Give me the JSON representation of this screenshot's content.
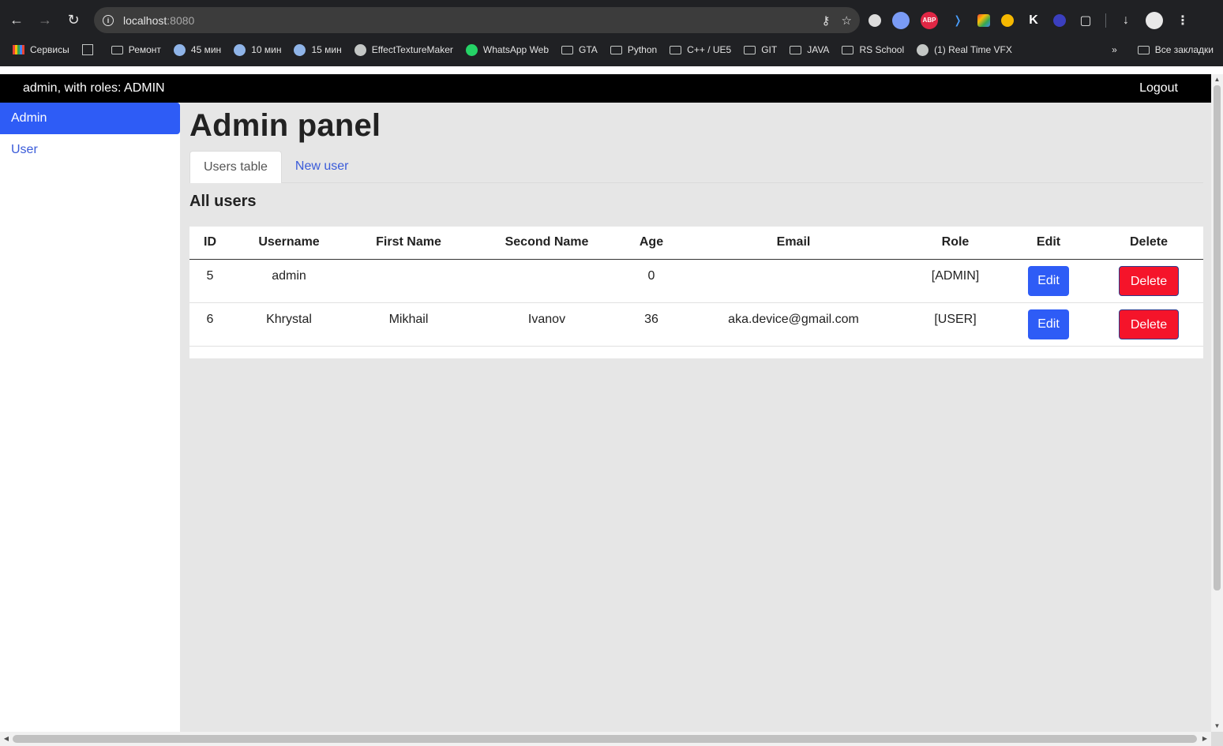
{
  "browser": {
    "url_host": "localhost",
    "url_port": ":8080",
    "icons": {
      "back": "arrow-left-icon",
      "forward": "arrow-right-icon",
      "reload": "reload-icon",
      "key": "key-icon",
      "star": "star-icon"
    },
    "bookmarks": [
      {
        "label": "Сервисы",
        "icon": "apps-grid-icon"
      },
      {
        "label": "",
        "icon": "tab-groups-icon"
      },
      {
        "label": "Ремонт",
        "icon": "folder-icon"
      },
      {
        "label": "45 мин",
        "icon": "timer-icon"
      },
      {
        "label": "10 мин",
        "icon": "timer-icon"
      },
      {
        "label": "15 мин",
        "icon": "timer-icon"
      },
      {
        "label": "EffectTextureMaker",
        "icon": "globe-icon"
      },
      {
        "label": "WhatsApp Web",
        "icon": "whatsapp-icon"
      },
      {
        "label": "GTA",
        "icon": "folder-icon"
      },
      {
        "label": "Python",
        "icon": "folder-icon"
      },
      {
        "label": "C++ / UE5",
        "icon": "folder-icon"
      },
      {
        "label": "GIT",
        "icon": "folder-icon"
      },
      {
        "label": "JAVA",
        "icon": "folder-icon"
      },
      {
        "label": "RS School",
        "icon": "folder-icon"
      },
      {
        "label": "(1) Real Time VFX",
        "icon": "globe-icon"
      }
    ],
    "bookmarks_more": "»",
    "all_bookmarks": "Все закладки",
    "extensions": {
      "abp_label": "ABP",
      "k_label": "K"
    }
  },
  "page": {
    "topnav": {
      "who": "admin, with roles: ADMIN",
      "logout": "Logout"
    },
    "sidebar": {
      "items": [
        {
          "label": "Admin",
          "active": true
        },
        {
          "label": "User",
          "active": false
        }
      ]
    },
    "title": "Admin panel",
    "tabs": [
      {
        "label": "Users table",
        "active": true
      },
      {
        "label": "New user",
        "active": false
      }
    ],
    "section_title": "All users",
    "table": {
      "headers": [
        "ID",
        "Username",
        "First Name",
        "Second Name",
        "Age",
        "Email",
        "Role",
        "Edit",
        "Delete"
      ],
      "rows": [
        {
          "id": "5",
          "username": "admin",
          "first_name": "",
          "second_name": "",
          "age": "0",
          "email": "",
          "role": "[ADMIN]",
          "edit": "Edit",
          "delete": "Delete"
        },
        {
          "id": "6",
          "username": "Khrystal",
          "first_name": "Mikhail",
          "second_name": "Ivanov",
          "age": "36",
          "email": "aka.device@gmail.com",
          "role": "[USER]",
          "edit": "Edit",
          "delete": "Delete"
        }
      ]
    }
  },
  "colors": {
    "primary": "#2e5cf6",
    "danger": "#f5142a",
    "navbar": "#000000",
    "content_bg": "#e6e6e6"
  }
}
